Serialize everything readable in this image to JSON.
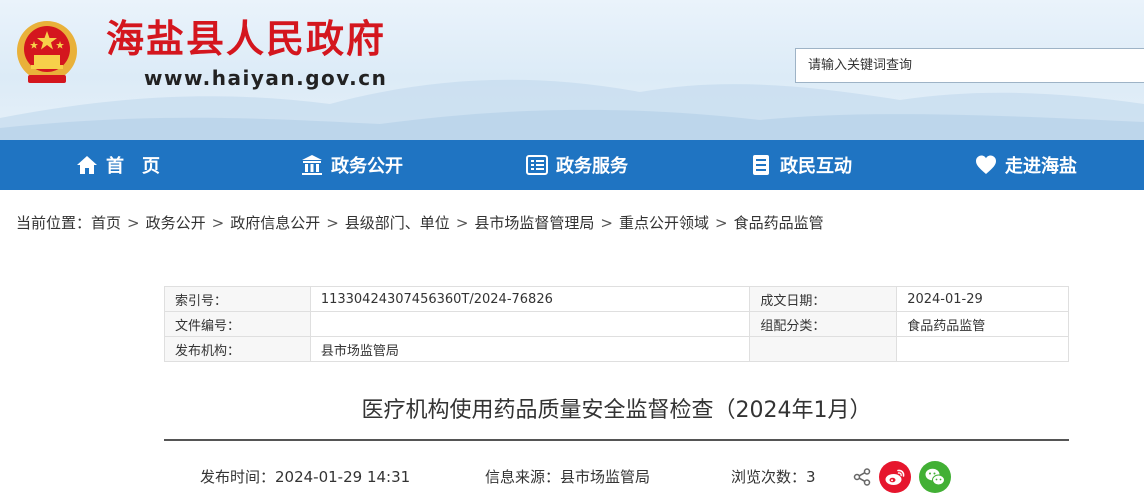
{
  "header": {
    "site_name": "海盐县人民政府",
    "site_url": "www.haiyan.gov.cn",
    "search_placeholder": "请输入关键词查询"
  },
  "nav": [
    {
      "label": "首　页",
      "icon": "home-icon"
    },
    {
      "label": "政务公开",
      "icon": "building-icon"
    },
    {
      "label": "政务服务",
      "icon": "service-list-icon"
    },
    {
      "label": "政民互动",
      "icon": "document-icon"
    },
    {
      "label": "走进海盐",
      "icon": "heart-icon"
    }
  ],
  "breadcrumb": {
    "prefix": "当前位置：",
    "items": [
      "首页",
      "政务公开",
      "政府信息公开",
      "县级部门、单位",
      "县市场监督管理局",
      "重点公开领域",
      "食品药品监管"
    ],
    "separator": ">"
  },
  "info": {
    "index_label": "索引号：",
    "index_value": "11330424307456360T/2024-76826",
    "date_label": "成文日期：",
    "date_value": "2024-01-29",
    "doc_no_label": "文件编号：",
    "doc_no_value": "",
    "category_label": "组配分类：",
    "category_value": "食品药品监管",
    "issuer_label": "发布机构：",
    "issuer_value": "县市场监管局"
  },
  "article": {
    "title": "医疗机构使用药品质量安全监督检查（2024年1月）",
    "publish_time": "发布时间：2024-01-29 14:31",
    "source": "信息来源：县市场监管局",
    "views": "浏览次数：3"
  },
  "colors": {
    "brand_red": "#d4161e",
    "nav_blue": "#1f74c2",
    "weibo_red": "#e6162d",
    "wechat_green": "#42b035"
  }
}
